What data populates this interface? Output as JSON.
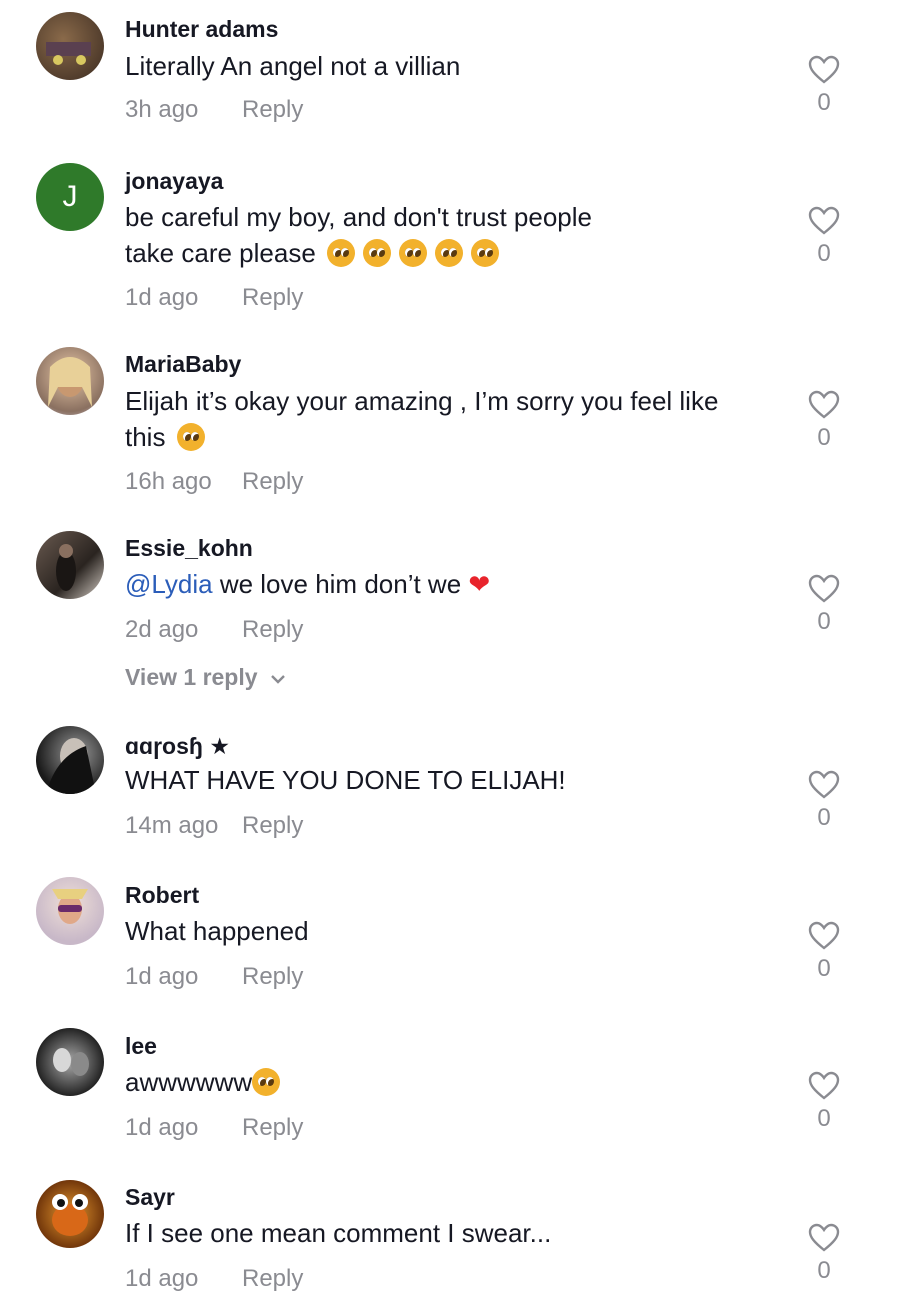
{
  "comments": [
    {
      "username": "Hunter adams",
      "text": "Literally An angel not a villian",
      "time": "3h ago",
      "reply": "Reply",
      "likes": "0"
    },
    {
      "username": "jonayaya",
      "avatar_letter": "J",
      "text_line1": "be careful my boy, and don't trust people",
      "text_line2": "take care please",
      "time": "1d ago",
      "reply": "Reply",
      "likes": "0"
    },
    {
      "username": "MariaBaby",
      "text_line1": "Elijah it’s okay your amazing , I’m sorry you feel like",
      "text_line2": "this",
      "time": "16h ago",
      "reply": "Reply",
      "likes": "0"
    },
    {
      "username": "Essie_kohn",
      "mention": "@Lydia",
      "text": " we love him don’t we ",
      "time": "2d ago",
      "reply": "Reply",
      "likes": "0",
      "view_replies": "View 1 reply"
    },
    {
      "username": "ɑɑɼosɧ ★",
      "text": "WHAT HAVE YOU DONE TO ELIJAH!",
      "time": "14m ago",
      "reply": "Reply",
      "likes": "0"
    },
    {
      "username": "Robert",
      "text": "What happened",
      "time": "1d ago",
      "reply": "Reply",
      "likes": "0"
    },
    {
      "username": "lee",
      "text": "awwwwww",
      "time": "1d ago",
      "reply": "Reply",
      "likes": "0"
    },
    {
      "username": "Sayr",
      "text": "If I see one mean comment I swear...",
      "time": "1d ago",
      "reply": "Reply",
      "likes": "0"
    }
  ],
  "icons": {
    "like": "heart-outline-icon",
    "emoji": "pleading-face-emoji",
    "red_heart": "red-heart-emoji",
    "chevron": "chevron-down-icon"
  },
  "colors": {
    "mention": "#2b5db9",
    "meta": "#8a8b91",
    "text": "#161823",
    "avatar_j": "#2f7a2a"
  }
}
